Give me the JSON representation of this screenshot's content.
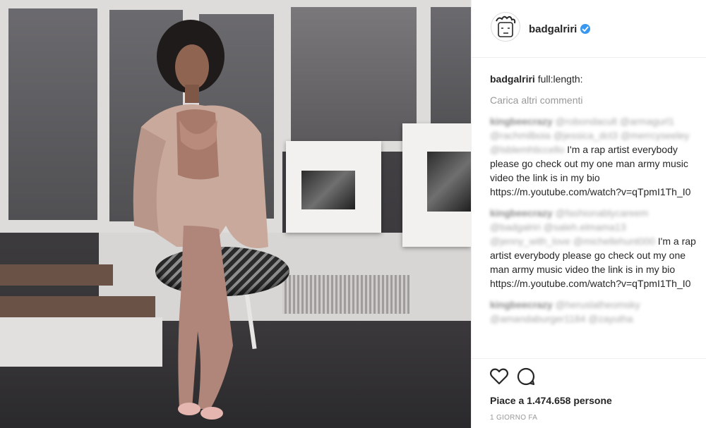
{
  "post": {
    "photo_alt": "post photo",
    "author": {
      "username": "badgalriri",
      "verified": true,
      "verified_color": "#3897f0"
    },
    "caption": {
      "username": "badgalriri",
      "text": "full:length:"
    },
    "load_more_label": "Carica altri commenti",
    "comments": [
      {
        "username": "kingbeecrazy",
        "mentions": "@robondacult @armagurl1 @rachmilboia @jessica_dct3 @merrcyseeley @lsblemhticcello",
        "text": "I'm a rap artist everybody please go check out my one man army music video the link is in my bio https://m.youtube.com/watch?v=qTpmI1Th_I0"
      },
      {
        "username": "kingbeecrazy",
        "mentions": "@fashionablycareem @badgalriri @saleh.elmama13 @jenny_with_love @michellehunt000",
        "text": "I'm a rap artist everybody please go check out my one man army music video the link is in my bio https://m.youtube.com/watch?v=qTpmI1Th_I0"
      },
      {
        "username": "kingbeecrazy",
        "mentions": "@heruslatheomsky @amandaburger1184 @zayutha",
        "text": ""
      }
    ],
    "actions": {
      "like_icon": "heart-icon",
      "comment_icon": "comment-icon"
    },
    "likes_label": "Piace a 1.474.658 persone",
    "timestamp": "1 GIORNO FA"
  }
}
